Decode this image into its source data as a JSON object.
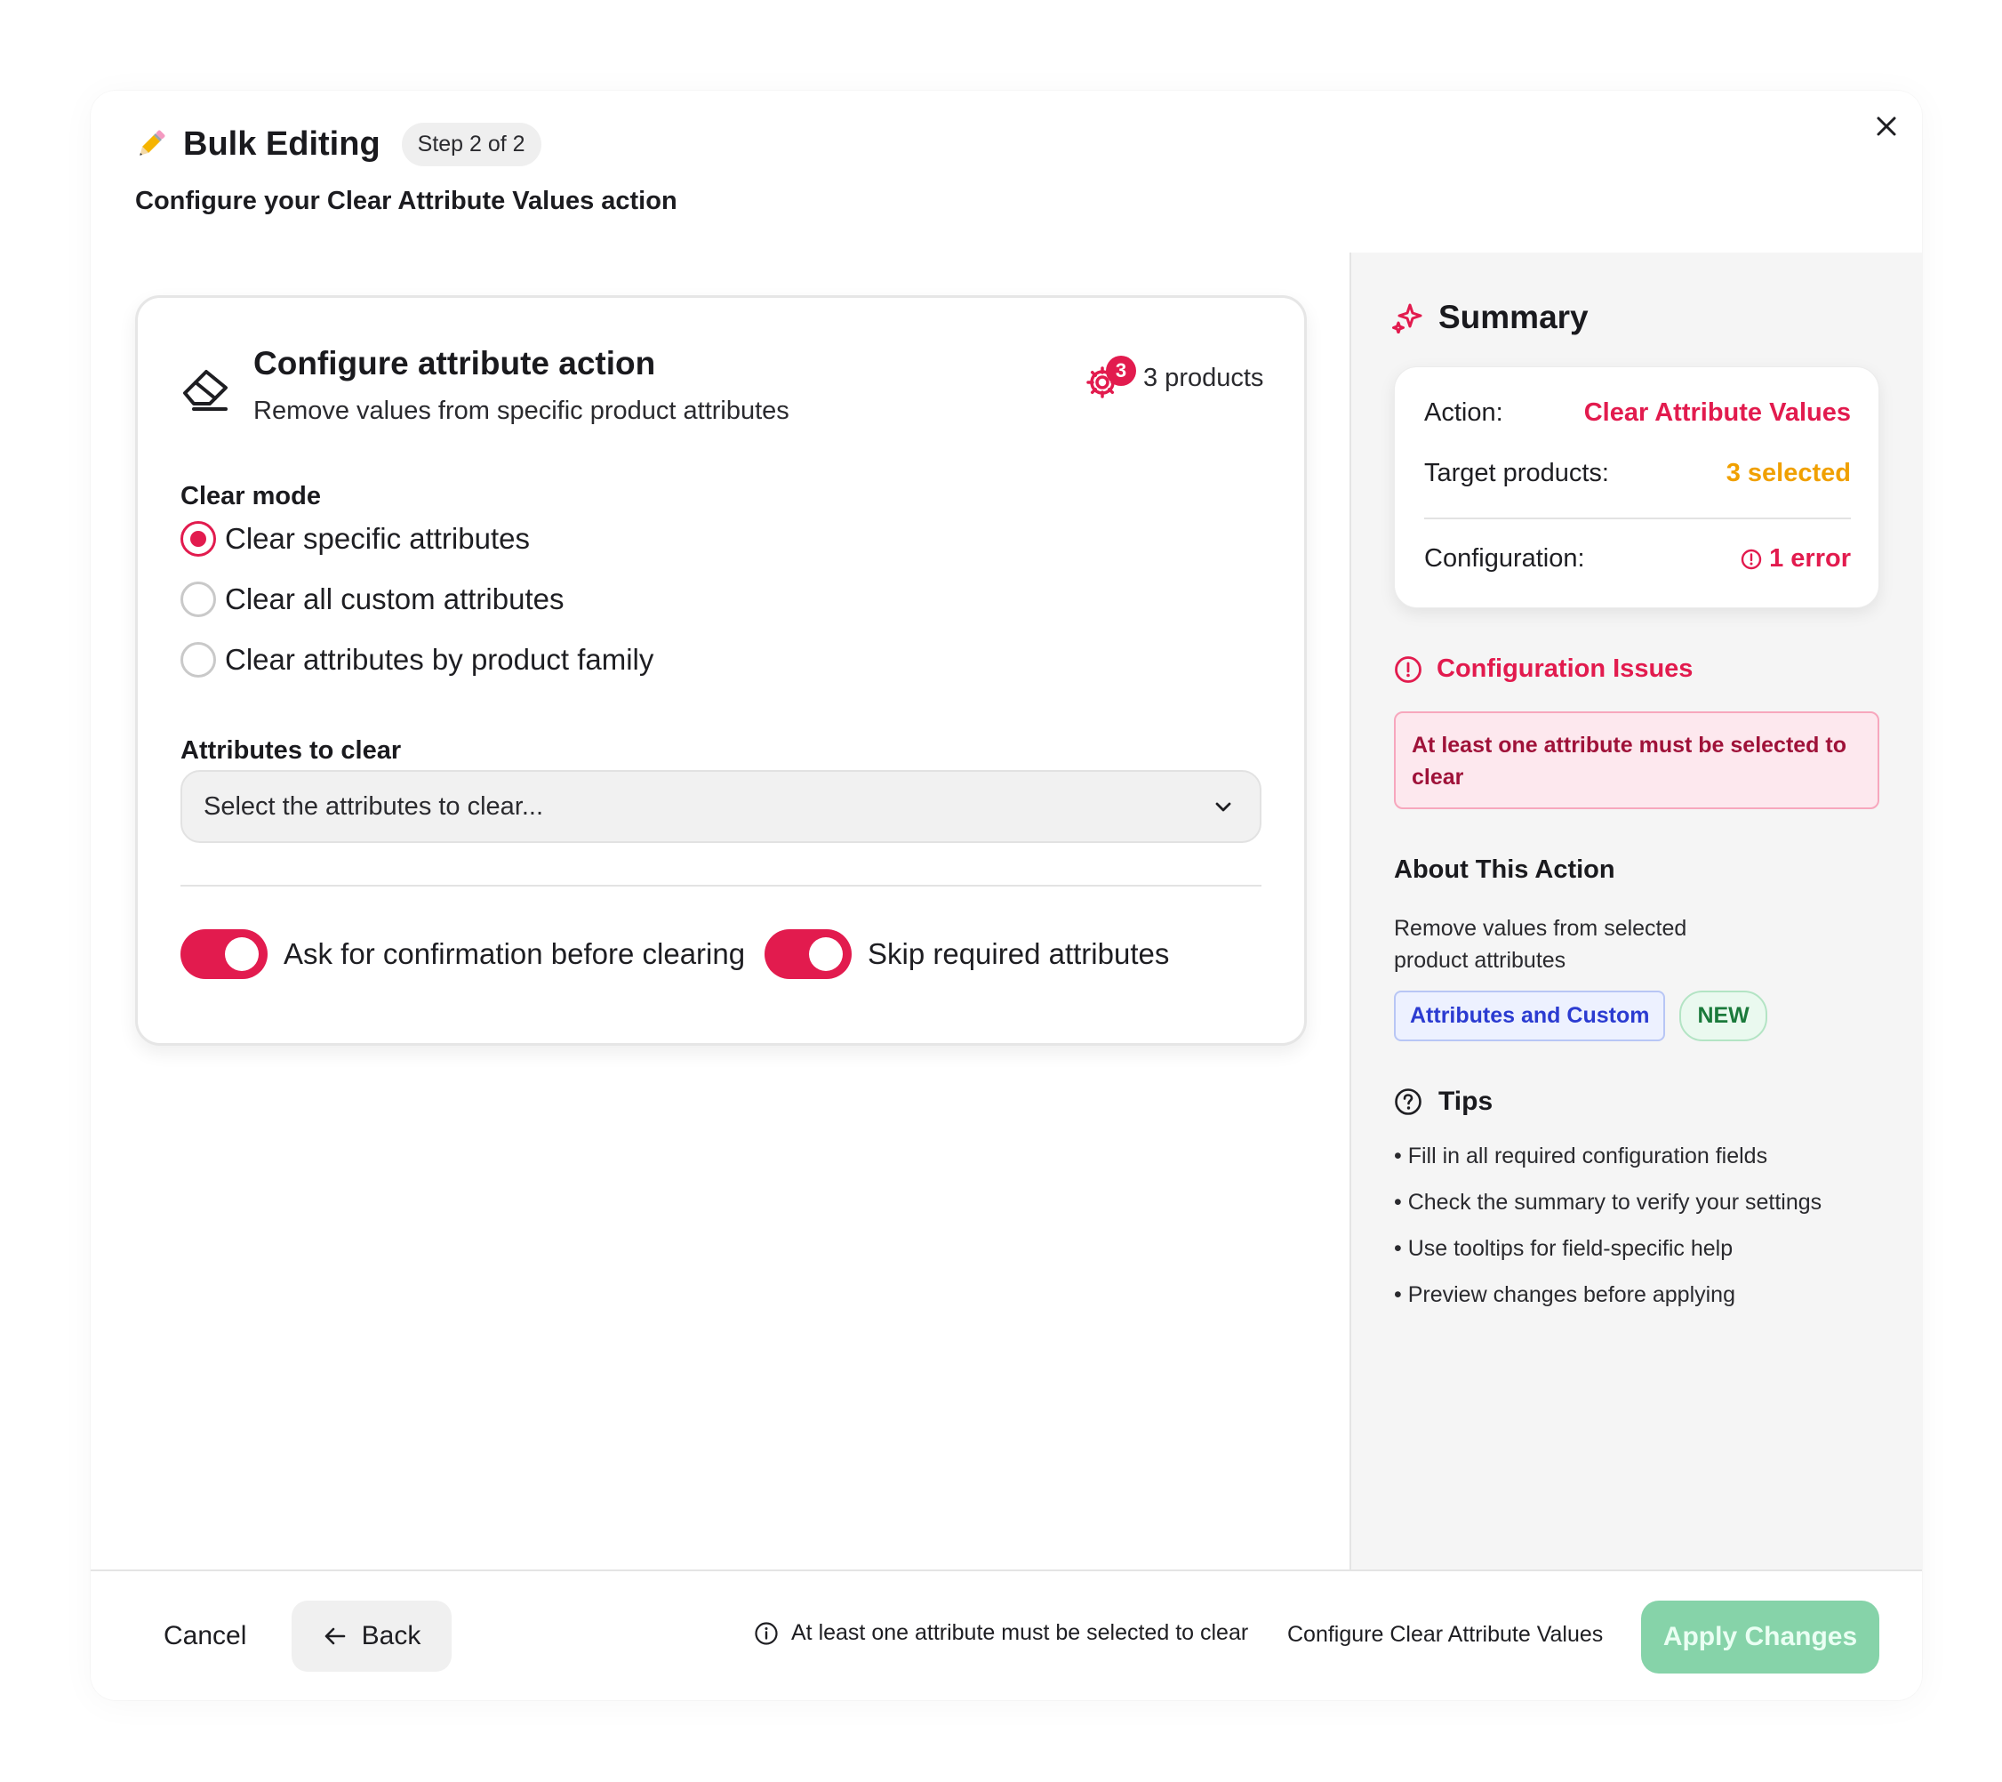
{
  "header": {
    "title": "Bulk Editing",
    "step": "Step 2 of 2",
    "subtitle_prefix": "Configure your",
    "subtitle_action": "Clear Attribute Values",
    "subtitle_suffix": "action"
  },
  "card": {
    "title": "Configure attribute action",
    "description": "Remove values from specific product attributes",
    "product_count": "3",
    "products_label": "3 products",
    "clear_mode_label": "Clear mode",
    "radios": [
      {
        "label": "Clear specific attributes",
        "checked": true
      },
      {
        "label": "Clear all custom attributes",
        "checked": false
      },
      {
        "label": "Clear attributes by product family",
        "checked": false
      }
    ],
    "attributes_label": "Attributes to clear",
    "attributes_placeholder": "Select the attributes to clear...",
    "toggles": [
      {
        "label": "Ask for confirmation before clearing",
        "on": true
      },
      {
        "label": "Skip required attributes",
        "on": true
      }
    ]
  },
  "summary": {
    "title": "Summary",
    "action_key": "Action:",
    "action_value": "Clear Attribute Values",
    "target_key": "Target products:",
    "target_value": "3 selected",
    "config_key": "Configuration:",
    "config_value": "1 error"
  },
  "issues": {
    "title": "Configuration Issues",
    "message": "At least one attribute must be selected to clear"
  },
  "about": {
    "title": "About This Action",
    "description": "Remove values from selected product attributes",
    "tag_category": "Attributes and Custom",
    "tag_new": "NEW"
  },
  "tips": {
    "title": "Tips",
    "items": [
      "Fill in all required configuration fields",
      "Check the summary to verify your settings",
      "Use tooltips for field-specific help",
      "Preview changes before applying"
    ]
  },
  "footer": {
    "cancel_label": "Cancel",
    "back_label": "Back",
    "validation_message": "At least one attribute must be selected to clear",
    "action_label": "Configure Clear Attribute Values",
    "apply_label": "Apply Changes"
  },
  "colors": {
    "accent": "#e21b4e",
    "warning": "#f0a000",
    "apply_disabled": "#86d3a9"
  },
  "icons": [
    "pencil-icon",
    "close-icon",
    "eraser-icon",
    "gear-icon",
    "sparkle-icon",
    "alert-circle-icon",
    "help-circle-icon",
    "info-icon",
    "arrow-left-icon",
    "chevron-down-icon"
  ]
}
